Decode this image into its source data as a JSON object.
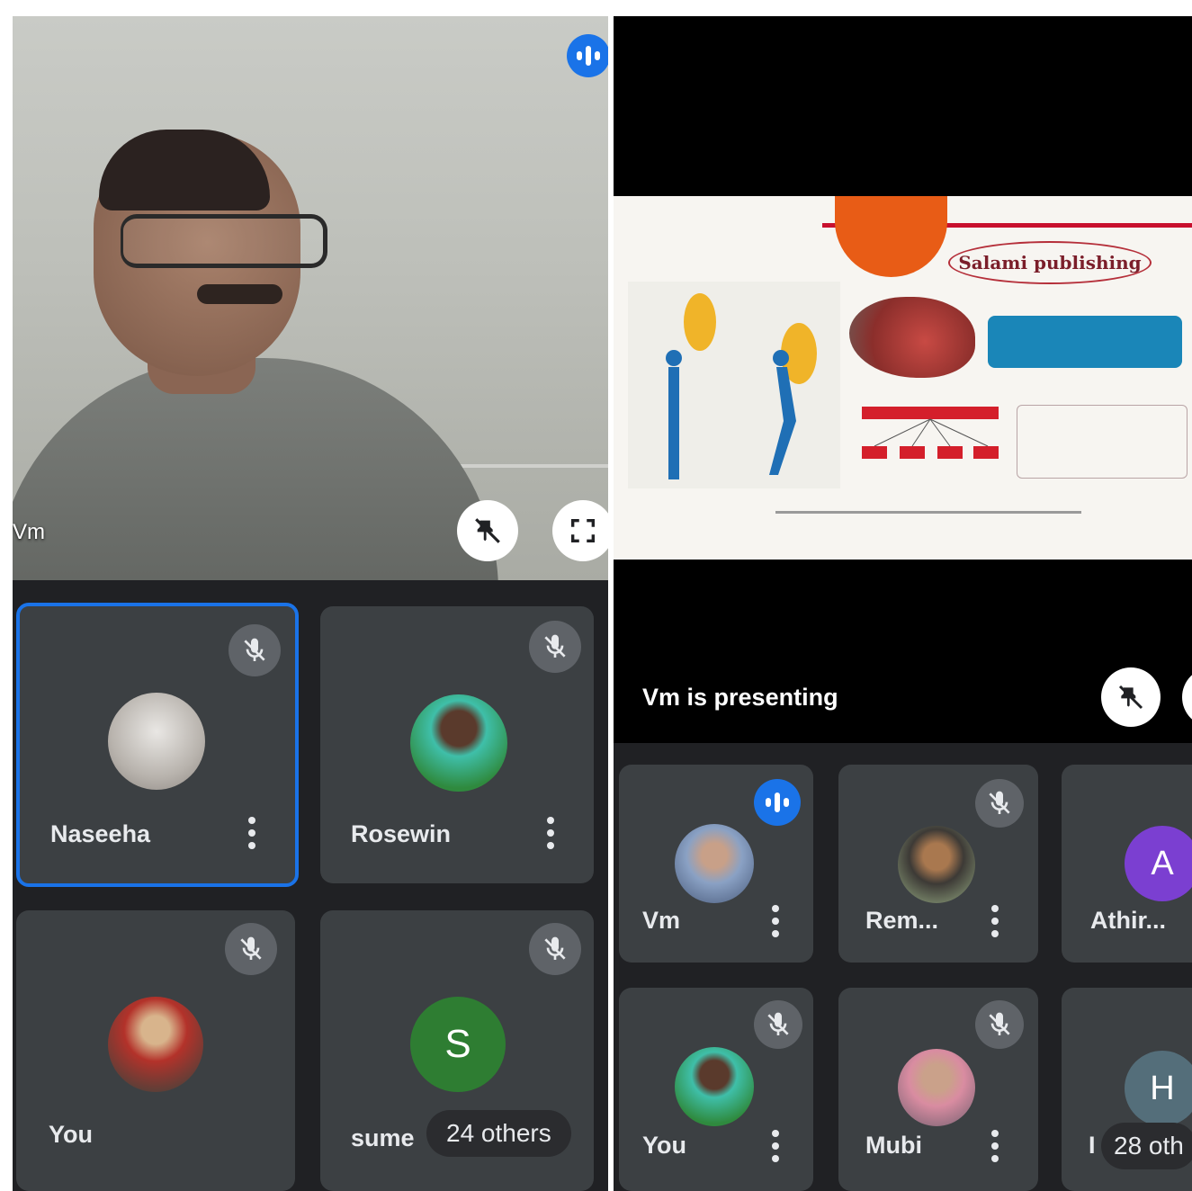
{
  "left_panel": {
    "speaker": {
      "name": "Vm"
    },
    "tiles": [
      {
        "name": "Naseeha",
        "avatar": "photo",
        "active": true
      },
      {
        "name": "Rosewin",
        "avatar": "photo"
      },
      {
        "name": "You",
        "avatar": "photo"
      },
      {
        "name": "sume",
        "avatar_letter": "S",
        "avatar_color": "#2e7d32"
      }
    ],
    "others_label": "24 others"
  },
  "right_panel": {
    "presenting_label": "Vm is presenting",
    "slide": {
      "title": "Salami publishing"
    },
    "tiles": [
      {
        "name": "Vm",
        "avatar": "photo"
      },
      {
        "name": "Rem...",
        "avatar": "photo"
      },
      {
        "name": "Athir...",
        "avatar_letter": "A",
        "avatar_color": "#7b3fd1"
      },
      {
        "name": "You",
        "avatar": "photo"
      },
      {
        "name": "Mubi",
        "avatar": "photo"
      },
      {
        "name": "I",
        "avatar_letter": "H",
        "avatar_color": "#546e7a"
      }
    ],
    "others_label": "28 oth"
  },
  "icons": {
    "speaking": "audio-wave-icon",
    "muted": "mic-off-icon",
    "more": "more-vert-icon",
    "unpin": "unpin-icon",
    "fullscreen": "fullscreen-icon"
  },
  "colors": {
    "accent": "#1a73e8",
    "tile_bg": "#3c4043",
    "grid_bg": "#202124"
  }
}
